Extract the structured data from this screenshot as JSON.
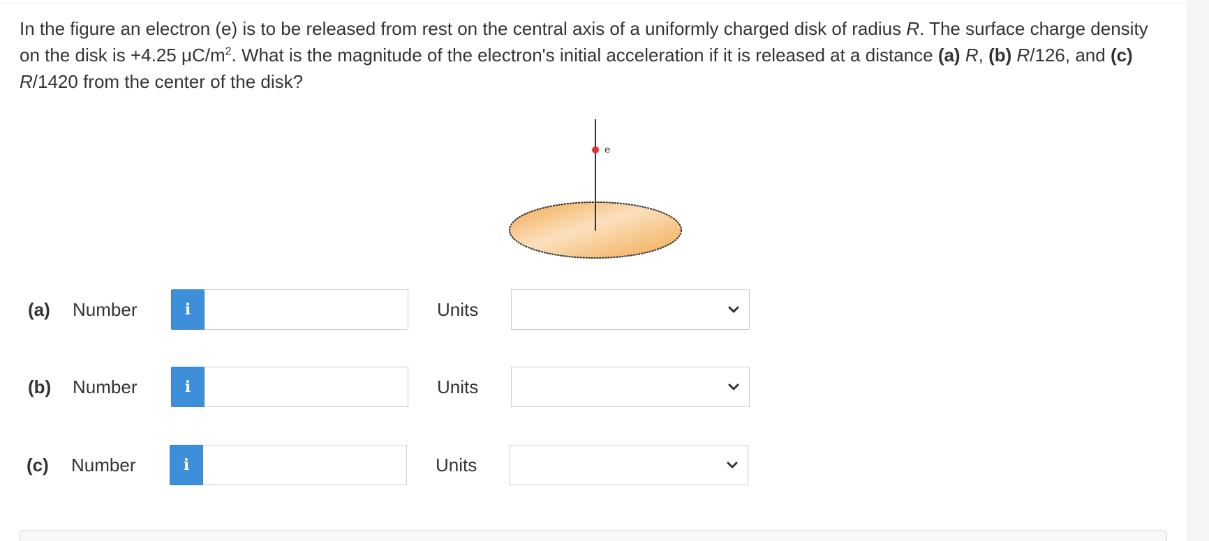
{
  "question": {
    "intro": "In the figure an electron (e) is to be released from rest on the central axis of a uniformly charged disk of radius ",
    "radius_symbol": "R",
    "mid1": ". The surface charge density on the disk is +4.25 μC/m",
    "exponent": "2",
    "mid2": ". What is the magnitude of the electron's initial acceleration if it is released at a distance ",
    "part_a": "(a)",
    "dist_a": "R",
    "sep1": ", ",
    "part_b": "(b)",
    "sep_b": " ",
    "dist_b_sym": "R",
    "dist_b": "/126, and ",
    "part_c": "(c)",
    "sep_c": " ",
    "dist_c_sym": "R",
    "dist_c": "/1420 from the center of the disk?"
  },
  "figure": {
    "electron_label": "e",
    "colors": {
      "disk_fill_light": "#fbe0bd",
      "disk_fill_dark": "#f2a94f",
      "electron": "#e03030"
    }
  },
  "parts": [
    {
      "label": "(a)",
      "number_label": "Number",
      "info_icon": "i",
      "number_value": "",
      "units_label": "Units",
      "units_value": ""
    },
    {
      "label": "(b)",
      "number_label": "Number",
      "info_icon": "i",
      "number_value": "",
      "units_label": "Units",
      "units_value": ""
    },
    {
      "label": "(c)",
      "number_label": "Number",
      "info_icon": "i",
      "number_value": "",
      "units_label": "Units",
      "units_value": ""
    }
  ],
  "colors": {
    "info_button": "#3d8fd9",
    "text": "#333333"
  }
}
